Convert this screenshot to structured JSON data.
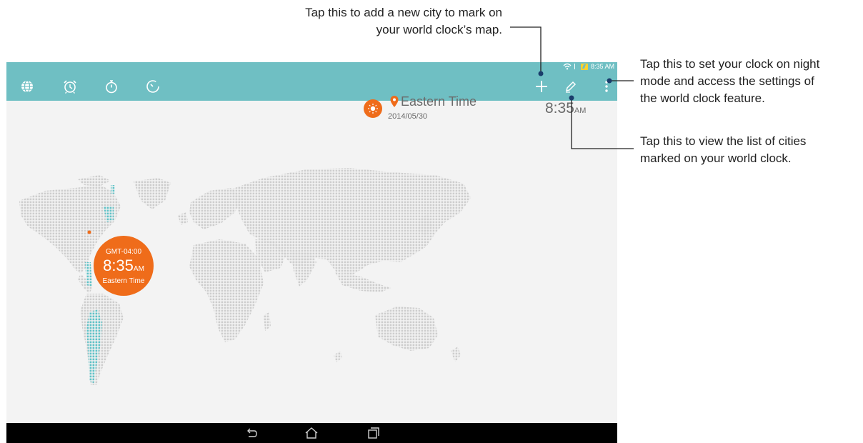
{
  "status_bar": {
    "time": "8:35 AM",
    "wifi_icon": "wifi-icon",
    "battery_icon": "battery-charging-icon"
  },
  "tabs": [
    {
      "name": "world-clock",
      "icon": "globe-icon"
    },
    {
      "name": "alarm",
      "icon": "alarm-clock-icon"
    },
    {
      "name": "stopwatch",
      "icon": "stopwatch-icon"
    },
    {
      "name": "timer",
      "icon": "timer-icon"
    }
  ],
  "actions": {
    "add_icon": "plus-icon",
    "edit_icon": "pencil-icon",
    "menu_icon": "overflow-menu-icon"
  },
  "city_card": {
    "name": "Eastern Time",
    "date": "2014/05/30",
    "time": "8:35",
    "ampm": "AM"
  },
  "map_bubble": {
    "gmt": "GMT-04:00",
    "time": "8:35",
    "ampm": "AM",
    "city": "Eastern Time"
  },
  "callouts": {
    "add_line1": "Tap this to add a new city to mark on",
    "add_line2": "your world clock’s map.",
    "menu_line1": "Tap this to set your clock on night",
    "menu_line2": "mode and access the settings of",
    "menu_line3": "the world clock feature.",
    "list_line1": "Tap this to view the list of cities",
    "list_line2": "marked on your world clock."
  },
  "nav_bar": {
    "back_icon": "back-icon",
    "home_icon": "home-icon",
    "recents_icon": "recent-apps-icon"
  },
  "colors": {
    "action_bar": "#6fbfc3",
    "accent": "#ef6c1a",
    "map_dots": "#cfcfcf",
    "map_highlight": "#5ec2c7"
  }
}
